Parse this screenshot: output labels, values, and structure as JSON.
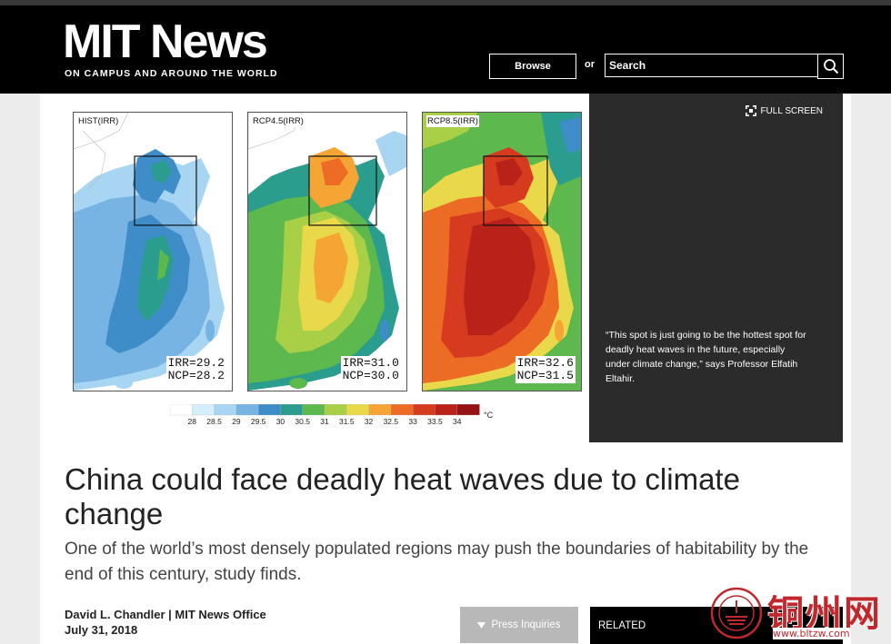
{
  "header": {
    "logo": "MIT News",
    "tagline": "ON CAMPUS AND AROUND THE WORLD",
    "browse_label": "Browse",
    "or_label": "or",
    "search_placeholder": "Search"
  },
  "figure": {
    "panels": [
      {
        "label": "HIST(IRR)",
        "irr": "IRR=29.2",
        "ncp": "NCP=28.2"
      },
      {
        "label": "RCP4.5(IRR)",
        "irr": "IRR=31.0",
        "ncp": "NCP=30.0"
      },
      {
        "label": "RCP8.5(IRR)",
        "irr": "IRR=32.6",
        "ncp": "NCP=31.5"
      }
    ],
    "colorbar": {
      "ticks": [
        "28",
        "28.5",
        "29",
        "29.5",
        "30",
        "30.5",
        "31",
        "31.5",
        "32",
        "32.5",
        "33",
        "33.5",
        "34"
      ],
      "unit": "°C",
      "colors": [
        "#ffffff",
        "#d4eefa",
        "#a7d5f2",
        "#78b4e3",
        "#3f8dc8",
        "#2a9d8f",
        "#5db84e",
        "#a8cf45",
        "#e8d84a",
        "#f4a534",
        "#ec6b25",
        "#d63b1f",
        "#b82219",
        "#951216"
      ]
    }
  },
  "sidebar": {
    "fullscreen_label": "FULL SCREEN",
    "caption": "“This spot is just going to be the hottest spot for deadly heat waves in the future, especially under climate change,” says Professor Elfatih Eltahir."
  },
  "article": {
    "headline": "China could face deadly heat waves due to climate change",
    "subhead": "One of the world’s most densely populated regions may push the boundaries of habitability by the end of this century, study finds.",
    "author": "David L. Chandler | MIT News Office",
    "date": "July 31, 2018",
    "press_label": "Press Inquiries",
    "related_label": "RELATED"
  },
  "watermark": {
    "text": "铜州网",
    "url": "www.bltzw.com"
  }
}
